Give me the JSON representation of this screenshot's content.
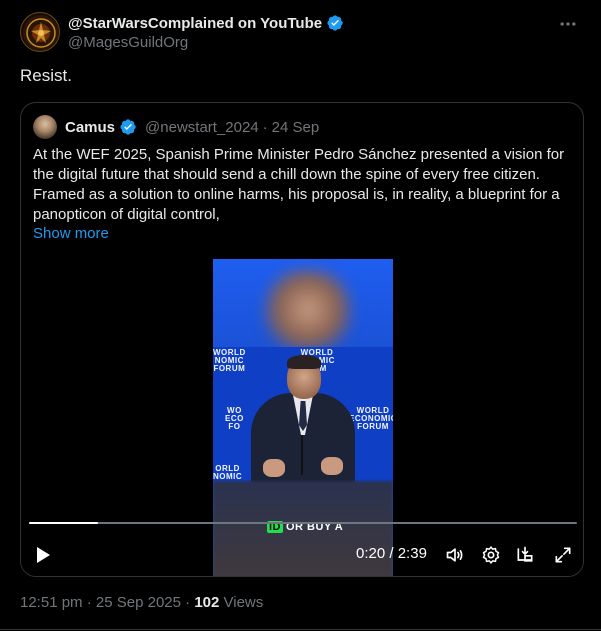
{
  "author": {
    "display_name": "@StarWarsComplained on YouTube",
    "handle": "@MagesGuildOrg"
  },
  "tweet": {
    "text": "Resist."
  },
  "quoted": {
    "name": "Camus",
    "handle": "@newstart_2024",
    "separator": "·",
    "date": "24 Sep",
    "text": "At the WEF 2025, Spanish Prime Minister Pedro Sánchez presented a vision for the digital future that should send a chill down the spine of every free citizen. Framed as a solution to online harms, his proposal is, in reality, a blueprint for a panopticon of digital control,",
    "show_more": "Show more",
    "video": {
      "backdrop_text": [
        "WORLD",
        "ECONOMIC",
        "FORUM"
      ],
      "backdrop_text_fragments": {
        "left_top": [
          "WORLD",
          "NOMIC",
          "FORUM"
        ],
        "center_top": [
          "WORLD",
          "ONOMIC",
          "RUM"
        ],
        "left_mid": [
          "WO",
          "ECO",
          "FO"
        ],
        "right_mid": [
          "WORLD",
          "ECONOMIC",
          "FORUM"
        ],
        "left_bottom": [
          "ORLD",
          "NOMIC"
        ]
      },
      "caption_highlight": "ID",
      "caption_rest": "OR BUY A",
      "time_current": "0:20",
      "time_separator": "/",
      "time_total": "2:39",
      "progress": 0.126
    }
  },
  "meta": {
    "time": "12:51 pm",
    "separator": "·",
    "date": "25 Sep 2025",
    "separator2": "·",
    "views_count": "102",
    "views_label": "Views"
  },
  "icons": {
    "verified": "verified-badge-icon",
    "more": "more-horizontal-icon",
    "play": "play-icon",
    "volume": "volume-icon",
    "settings": "gear-icon",
    "pip": "picture-in-picture-icon",
    "fullscreen": "fullscreen-icon"
  },
  "colors": {
    "background": "#000000",
    "text": "#e7e9ea",
    "secondary_text": "#71767b",
    "link": "#1d9bf0",
    "verified": "#1d9bf0",
    "caption_highlight": "#22e04a"
  }
}
